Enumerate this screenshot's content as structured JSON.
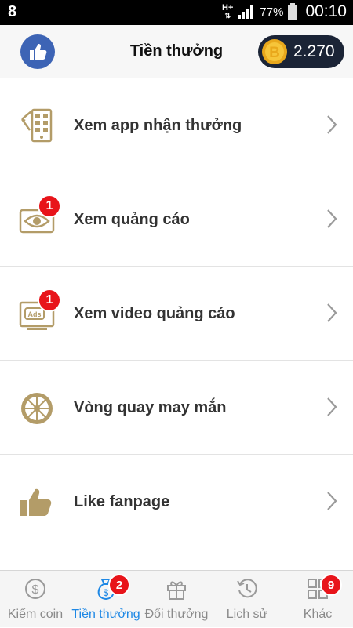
{
  "status_bar": {
    "network": "H+",
    "battery": "77%",
    "time": "00:10"
  },
  "header": {
    "title": "Tiền thưởng",
    "coins": "2.270",
    "coin_symbol": "B"
  },
  "menu": {
    "items": [
      {
        "label": "Xem app nhận thưởng",
        "icon": "phone-app-icon",
        "badge": ""
      },
      {
        "label": "Xem quảng cáo",
        "icon": "eye-icon",
        "badge": "1"
      },
      {
        "label": "Xem video quảng cáo",
        "icon": "ads-screen-icon",
        "badge": "1"
      },
      {
        "label": "Vòng quay may mắn",
        "icon": "lucky-wheel-icon",
        "badge": ""
      },
      {
        "label": "Like fanpage",
        "icon": "thumbs-up-icon",
        "badge": ""
      }
    ]
  },
  "bottom_nav": {
    "items": [
      {
        "label": "Kiếm coin",
        "icon": "dollar-coin-icon",
        "badge": ""
      },
      {
        "label": "Tiền thưởng",
        "icon": "money-bag-icon",
        "badge": "2"
      },
      {
        "label": "Đổi thưởng",
        "icon": "gift-icon",
        "badge": ""
      },
      {
        "label": "Lịch sử",
        "icon": "history-icon",
        "badge": ""
      },
      {
        "label": "Khác",
        "icon": "grid-icon",
        "badge": "9"
      }
    ]
  },
  "colors": {
    "accent": "#1e88e5",
    "icon_gold": "#b39c68",
    "badge": "#e8141a",
    "like_button": "#3d64b5"
  }
}
